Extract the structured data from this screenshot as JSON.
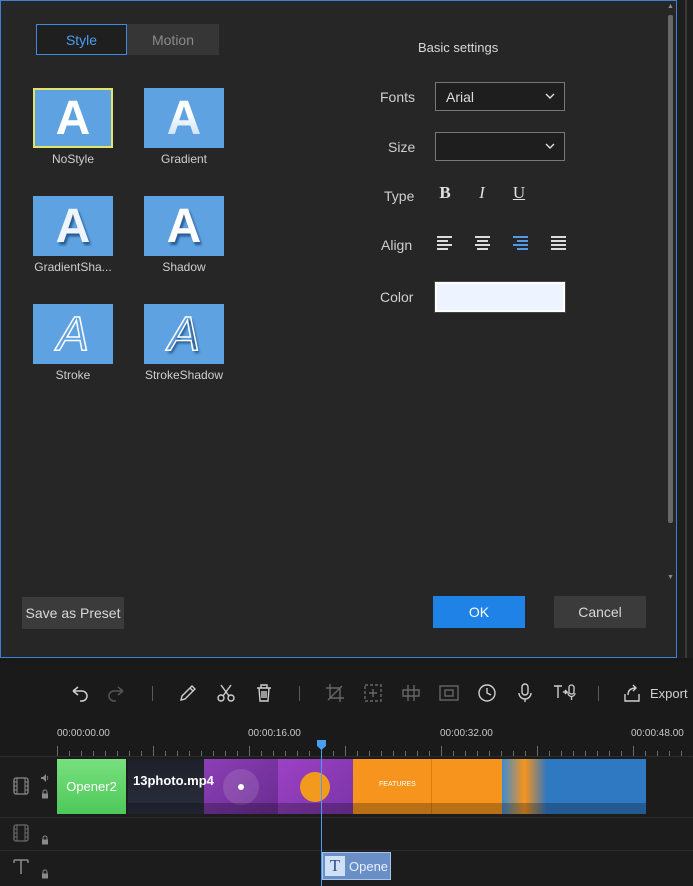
{
  "dialog": {
    "tabs": [
      {
        "label": "Style"
      },
      {
        "label": "Motion"
      }
    ],
    "styles": [
      {
        "label": "NoStyle",
        "glyph": "A",
        "selected": true
      },
      {
        "label": "Gradient",
        "glyph": "A"
      },
      {
        "label": "GradientSha...",
        "glyph": "A"
      },
      {
        "label": "Shadow",
        "glyph": "A"
      },
      {
        "label": "Stroke",
        "glyph": "A"
      },
      {
        "label": "StrokeShadow",
        "glyph": "A"
      }
    ],
    "basic_title": "Basic settings",
    "fonts": {
      "label": "Fonts",
      "value": "Arial"
    },
    "size": {
      "label": "Size",
      "value": ""
    },
    "type": {
      "label": "Type",
      "bold": "B",
      "italic": "I",
      "underline": "U"
    },
    "align": {
      "label": "Align",
      "active": "right"
    },
    "color": {
      "label": "Color",
      "value": "#edf4ff"
    },
    "buttons": {
      "save_preset": "Save as Preset",
      "ok": "OK",
      "cancel": "Cancel"
    }
  },
  "toolbar": {
    "tools": [
      "undo-icon",
      "redo-icon",
      "pencil-icon",
      "scissors-icon",
      "trash-icon",
      "crop-icon",
      "zoom-icon",
      "mosaic-icon",
      "freeze-icon",
      "speed-icon",
      "mic-icon",
      "text-to-speech-icon",
      "export-icon"
    ],
    "export_label": "Export"
  },
  "timeline": {
    "times": [
      "00:00:00.00",
      "00:00:16.00",
      "00:00:32.00",
      "00:00:48.00"
    ],
    "clips": {
      "opener": "Opener2",
      "video": "13photo.mp4",
      "text": "Opene"
    }
  },
  "colors": {
    "accent": "#1f82e6",
    "border": "#3d7fd3",
    "thumb_bg": "#5ea2e2",
    "selected_outline": "#e3e36a"
  }
}
